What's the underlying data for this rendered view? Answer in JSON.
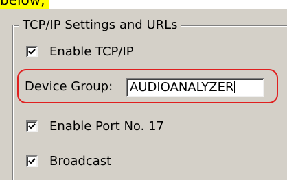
{
  "top_text": "below,",
  "group": {
    "title": "TCP/IP Settings and URLs"
  },
  "options": [
    {
      "label": "Enable TCP/IP",
      "checked": true
    },
    {
      "label": "Enable Port No. 17",
      "checked": true
    },
    {
      "label": "Broadcast",
      "checked": true
    }
  ],
  "device_group": {
    "label": "Device Group:",
    "value": "AUDIOANALYZER"
  },
  "colors": {
    "panel": "#d4d0c8",
    "highlight_text": "#ffff00",
    "annotation_border": "#e02020"
  }
}
